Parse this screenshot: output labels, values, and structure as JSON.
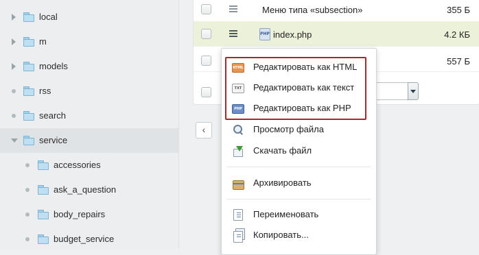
{
  "sidebar": {
    "items": [
      {
        "label": "local",
        "toggle": "collapsed"
      },
      {
        "label": "m",
        "toggle": "collapsed"
      },
      {
        "label": "models",
        "toggle": "collapsed"
      },
      {
        "label": "rss",
        "toggle": "leaf"
      },
      {
        "label": "search",
        "toggle": "leaf"
      },
      {
        "label": "service",
        "toggle": "expanded",
        "selected": true
      },
      {
        "label": "accessories",
        "toggle": "leaf"
      },
      {
        "label": "ask_a_question",
        "toggle": "leaf"
      },
      {
        "label": "body_repairs",
        "toggle": "leaf"
      },
      {
        "label": "budget_service",
        "toggle": "leaf"
      }
    ]
  },
  "files": {
    "rows": [
      {
        "name": "Меню типа «subsection»",
        "size": "355 Б",
        "icon": "none"
      },
      {
        "name": "index.php",
        "size": "4.2 КБ",
        "icon": "php-file-icon"
      },
      {
        "name": "",
        "size": "557 Б",
        "icon": "none"
      }
    ],
    "pager_prev": "‹"
  },
  "context_menu": {
    "edit_html": "Редактировать как HTML",
    "edit_text": "Редактировать как текст",
    "edit_php": "Редактировать как PHP",
    "view_file": "Просмотр файла",
    "download_file": "Скачать файл",
    "archive": "Архивировать",
    "rename": "Переименовать",
    "copy": "Копировать..."
  },
  "icons": {
    "edit_html": "HTML",
    "edit_text": "TXT",
    "edit_php": "PHP"
  },
  "colors": {
    "highlight_border": "#a8262b",
    "hover_row": "#ecf1d9",
    "selected_tree_row": "#dfe3e5"
  }
}
